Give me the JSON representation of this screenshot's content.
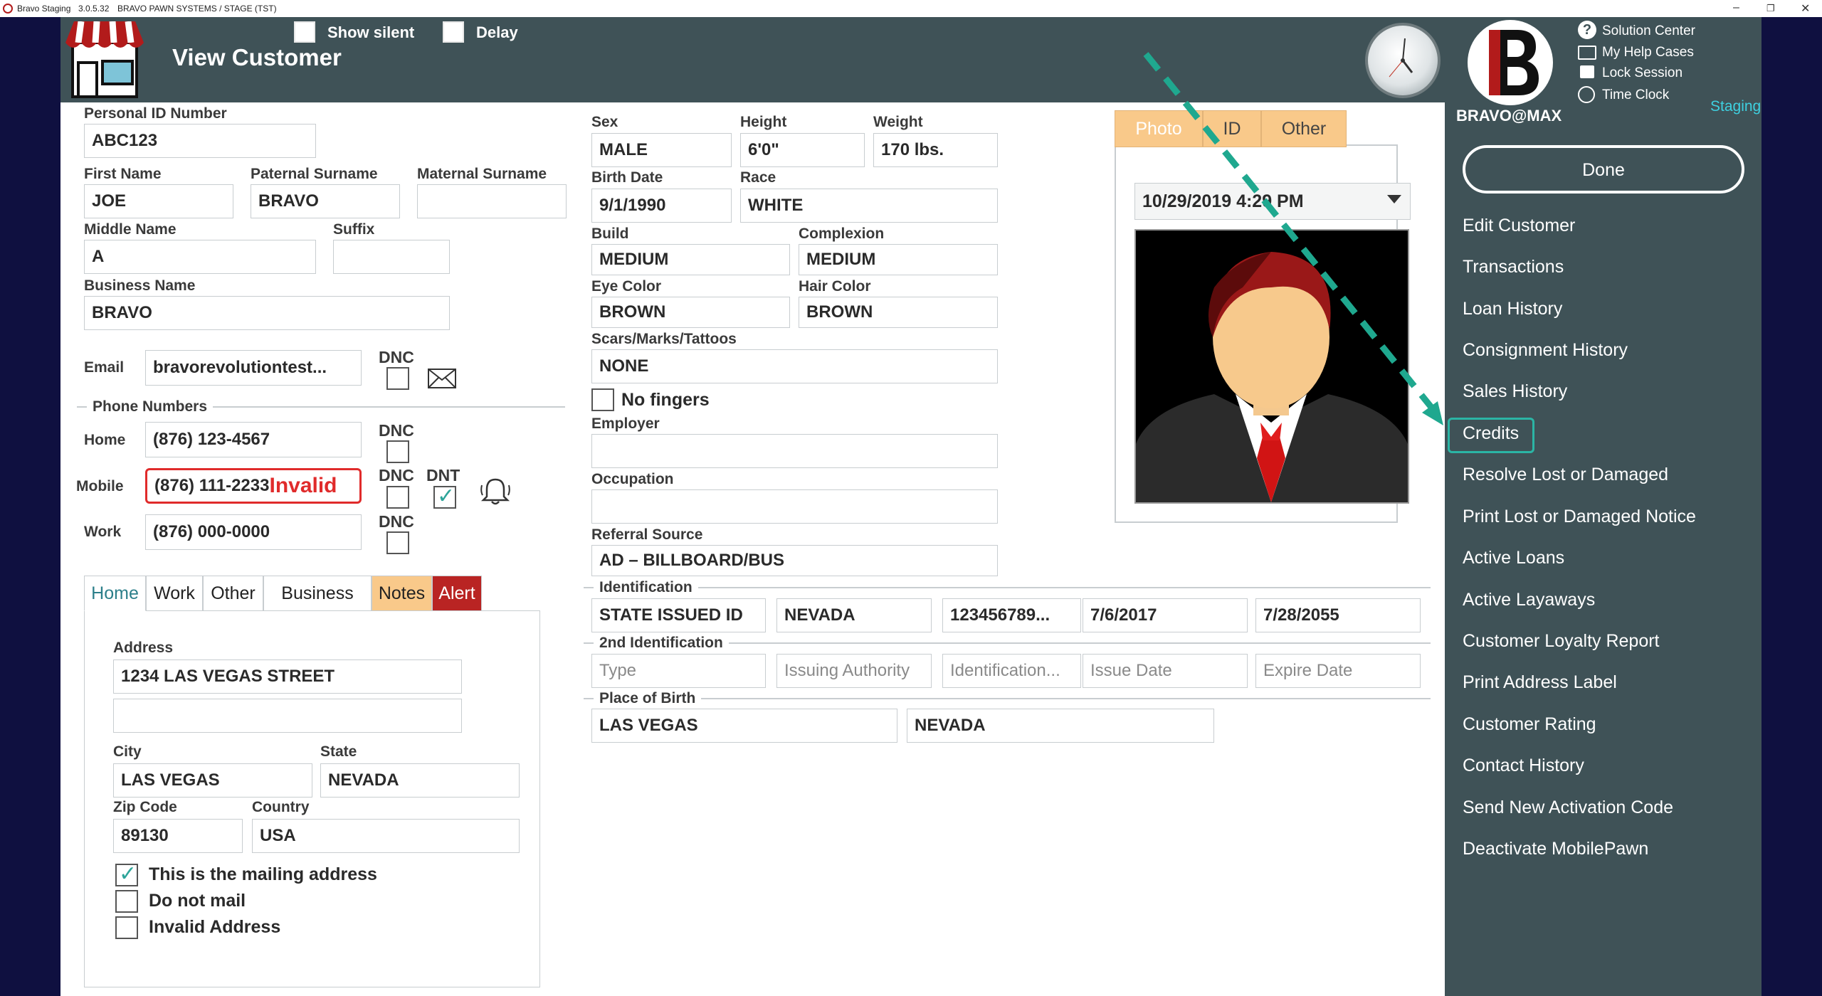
{
  "titlebar": {
    "app_name": "Bravo Staging",
    "version": "3.0.5.32",
    "system": "BRAVO PAWN SYSTEMS / STAGE (TST)"
  },
  "header": {
    "title": "View Customer",
    "show_silent_label": "Show silent",
    "delay_label": "Delay",
    "user": "BRAVO@MAX",
    "staging": "Staging",
    "links": [
      "Solution Center",
      "My Help Cases",
      "Lock Session",
      "Time Clock"
    ]
  },
  "sidebar": {
    "done": "Done",
    "items": [
      "Edit Customer",
      "Transactions",
      "Loan History",
      "Consignment History",
      "Sales History",
      "Credits",
      "Resolve Lost or Damaged",
      "Print Lost or Damaged Notice",
      "Active Loans",
      "Active Layaways",
      "Customer Loyalty Report",
      "Print Address Label",
      "Customer Rating",
      "Contact History",
      "Send New Activation Code",
      "Deactivate MobilePawn"
    ]
  },
  "customer": {
    "labels": {
      "pin": "Personal ID Number",
      "first": "First Name",
      "paternal": "Paternal Surname",
      "maternal": "Maternal Surname",
      "middle": "Middle Name",
      "suffix": "Suffix",
      "business": "Business Name",
      "email": "Email",
      "dnc": "DNC",
      "dnt": "DNT",
      "phone_numbers": "Phone Numbers",
      "home": "Home",
      "mobile": "Mobile",
      "work": "Work"
    },
    "pin": "ABC123",
    "first": "JOE",
    "paternal": "BRAVO",
    "maternal": "",
    "middle": "A",
    "suffix": "",
    "business": "BRAVO",
    "email": "bravorevolutiontest...",
    "phone_home": "(876) 123-4567",
    "phone_mobile": "(876) 111-2233",
    "phone_mobile_status": "Invalid",
    "phone_work": "(876) 000-0000"
  },
  "address_tabs": [
    "Home",
    "Work",
    "Other",
    "Business",
    "Notes",
    "Alert"
  ],
  "address": {
    "labels": {
      "address": "Address",
      "city": "City",
      "state": "State",
      "zip": "Zip Code",
      "country": "Country"
    },
    "line1": "1234 LAS VEGAS STREET",
    "line2": "",
    "city": "LAS VEGAS",
    "state": "NEVADA",
    "zip": "89130",
    "country": "USA",
    "mailing_label": "This is the mailing address",
    "do_not_mail_label": "Do not mail",
    "invalid_label": "Invalid Address",
    "mailing_checked": true,
    "do_not_mail_checked": false,
    "invalid_checked": false
  },
  "physical": {
    "labels": {
      "sex": "Sex",
      "height": "Height",
      "weight": "Weight",
      "birth": "Birth Date",
      "race": "Race",
      "build": "Build",
      "complexion": "Complexion",
      "eye": "Eye Color",
      "hair": "Hair Color",
      "scars": "Scars/Marks/Tattoos",
      "no_fingers": "No fingers",
      "employer": "Employer",
      "occupation": "Occupation",
      "referral": "Referral Source"
    },
    "sex": "MALE",
    "height": "6'0\"",
    "weight": "170 lbs.",
    "birth": "9/1/1990",
    "race": "WHITE",
    "build": "MEDIUM",
    "complexion": "MEDIUM",
    "eye": "BROWN",
    "hair": "BROWN",
    "scars": "NONE",
    "employer": "",
    "occupation": "",
    "referral": "AD – BILLBOARD/BUS"
  },
  "identification": {
    "title": "Identification",
    "values": [
      "STATE ISSUED ID",
      "NEVADA",
      "123456789...",
      "7/6/2017",
      "7/28/2055"
    ],
    "second_title": "2nd Identification",
    "second_placeholders": [
      "Type",
      "Issuing Authority",
      "Identification...",
      "Issue Date",
      "Expire Date"
    ],
    "birth_title": "Place of Birth",
    "birth_city": "LAS VEGAS",
    "birth_state": "NEVADA"
  },
  "photo": {
    "tabs": [
      "Photo",
      "ID",
      "Other"
    ],
    "timestamp": "10/29/2019 4:29 PM"
  },
  "colors": {
    "header": "#3f5257",
    "accent": "#2bb5a5",
    "tab_orange": "#f9c98a",
    "alert_red": "#b92423"
  }
}
